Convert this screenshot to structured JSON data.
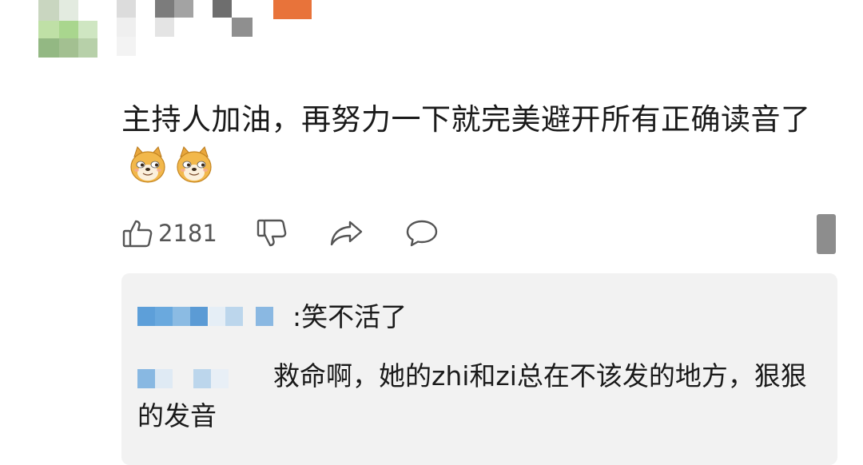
{
  "comment": {
    "text": "主持人加油，再努力一下就完美避开所有正确读音了",
    "emoji_icon": "doge-icon",
    "emoji_count": 2
  },
  "actions": {
    "like_icon": "thumbs-up-icon",
    "like_count": "2181",
    "dislike_icon": "thumbs-down-icon",
    "share_icon": "share-icon",
    "reply_icon": "comment-bubble-icon"
  },
  "replies": [
    {
      "text": ":笑不活了"
    },
    {
      "text": "救命啊，她的zhi和zi总在不该发的地方，狠狠的发音"
    }
  ],
  "colors": {
    "background": "#ffffff",
    "reply_panel": "#f2f2f2",
    "text": "#1a1a1a",
    "icon": "#555555",
    "avatar_accent": "#e8733a"
  }
}
